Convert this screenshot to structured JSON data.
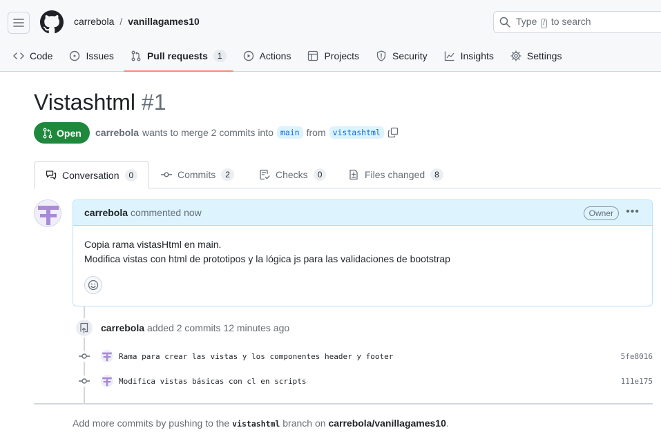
{
  "header": {
    "owner": "carrebola",
    "separator": "/",
    "repo": "vanillagames10",
    "search": {
      "before": "Type",
      "key": "/",
      "after": "to search"
    }
  },
  "repo_tabs": [
    {
      "label": "Code",
      "icon": "code-icon"
    },
    {
      "label": "Issues",
      "icon": "issue-icon"
    },
    {
      "label": "Pull requests",
      "icon": "pull-request-icon",
      "count": "1",
      "selected": true
    },
    {
      "label": "Actions",
      "icon": "play-icon"
    },
    {
      "label": "Projects",
      "icon": "table-icon"
    },
    {
      "label": "Security",
      "icon": "shield-icon"
    },
    {
      "label": "Insights",
      "icon": "graph-icon"
    },
    {
      "label": "Settings",
      "icon": "gear-icon"
    }
  ],
  "pr": {
    "title": "Vistashtml",
    "number": "#1",
    "state": "Open",
    "author": "carrebola",
    "merge_text": "wants to merge 2 commits into",
    "base": "main",
    "from_text": "from",
    "head": "vistashtml"
  },
  "pr_tabs": [
    {
      "label": "Conversation",
      "count": "0",
      "icon": "comment-discussion-icon"
    },
    {
      "label": "Commits",
      "count": "2",
      "icon": "commit-icon"
    },
    {
      "label": "Checks",
      "count": "0",
      "icon": "checklist-icon"
    },
    {
      "label": "Files changed",
      "count": "8",
      "icon": "file-diff-icon"
    }
  ],
  "comment": {
    "author": "carrebola",
    "action": "commented now",
    "badge": "Owner",
    "lines": [
      "Copia rama vistasHtml en main.",
      "Modifica vistas con html de prototipos y la lógica js para las validaciones de bootstrap"
    ]
  },
  "event": {
    "author": "carrebola",
    "text": "added 2 commits 12 minutes ago"
  },
  "commits": [
    {
      "message": "Rama para crear las vistas y los componentes header y footer",
      "sha": "5fe8016"
    },
    {
      "message": "Modifica vistas básicas con cl en scripts",
      "sha": "111e175"
    }
  ],
  "footer": {
    "pre": "Add more commits by pushing to the",
    "branch": "vistashtml",
    "mid": "branch on",
    "repo": "carrebola/vanillagames10",
    "post": "."
  },
  "colors": {
    "accent_open": "#1f883d",
    "tab_underline": "#fd8c73",
    "comment_header": "#ddf4ff",
    "branch_bg": "#ddf4ff",
    "link": "#0969da"
  }
}
